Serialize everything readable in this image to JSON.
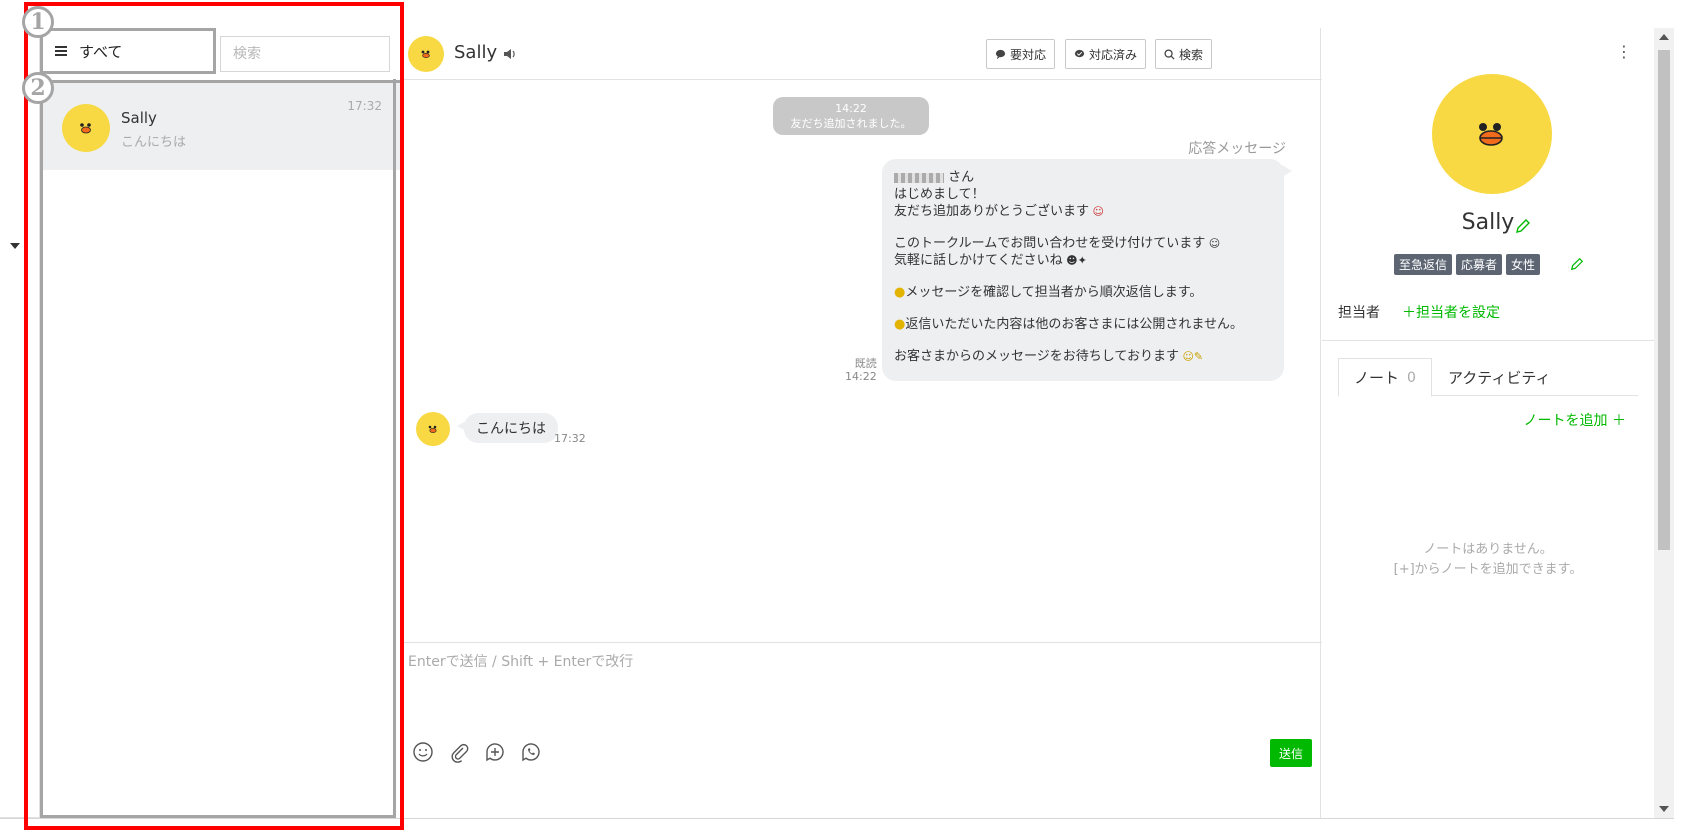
{
  "colors": {
    "accent_green": "#00b900",
    "annotation_red": "#ff0000",
    "annotation_gray": "#a5a5a5",
    "avatar_yellow": "#f8d943"
  },
  "annotations": {
    "badge1": "1",
    "badge2": "2"
  },
  "list": {
    "filter_label": "すべて",
    "search_placeholder": "検索",
    "chat": {
      "name": "Sally",
      "preview": "こんにちは",
      "time": "17:32"
    }
  },
  "conversation": {
    "title": "Sally",
    "buttons": {
      "needs_action": "要対応",
      "resolved": "対応済み",
      "search": "検索"
    },
    "system": {
      "time": "14:22",
      "text": "友だち追加されました。"
    },
    "auto_label": "応答メッセージ",
    "auto_message": {
      "line1": "さん",
      "line2": "はじめまして！",
      "line3": "友だち追加ありがとうございます",
      "line4": "このトークルームでお問い合わせを受け付けています",
      "line5": "気軽に話しかけてくださいね",
      "line6": "メッセージを確認して担当者から順次返信します。",
      "line7": "返信いただいた内容は他のお客さまには公開されません。",
      "line8": "お客さまからのメッセージをお待ちしております"
    },
    "read": {
      "label": "既読",
      "time": "14:22"
    },
    "incoming": {
      "text": "こんにちは",
      "time": "17:32"
    },
    "composer_placeholder": "Enterで送信 / Shift + Enterで改行",
    "send_label": "送信"
  },
  "profile": {
    "menu": "⋮",
    "name": "Sally",
    "tags": [
      "至急返信",
      "応募者",
      "女性"
    ],
    "owner_label": "担当者",
    "owner_link": "＋担当者を設定",
    "tabs": {
      "note": "ノート",
      "note_count": "0",
      "activity": "アクティビティ"
    },
    "add_note": "ノートを追加 ＋",
    "empty_line1": "ノートはありません。",
    "empty_line2": "[+]からノートを追加できます。"
  }
}
